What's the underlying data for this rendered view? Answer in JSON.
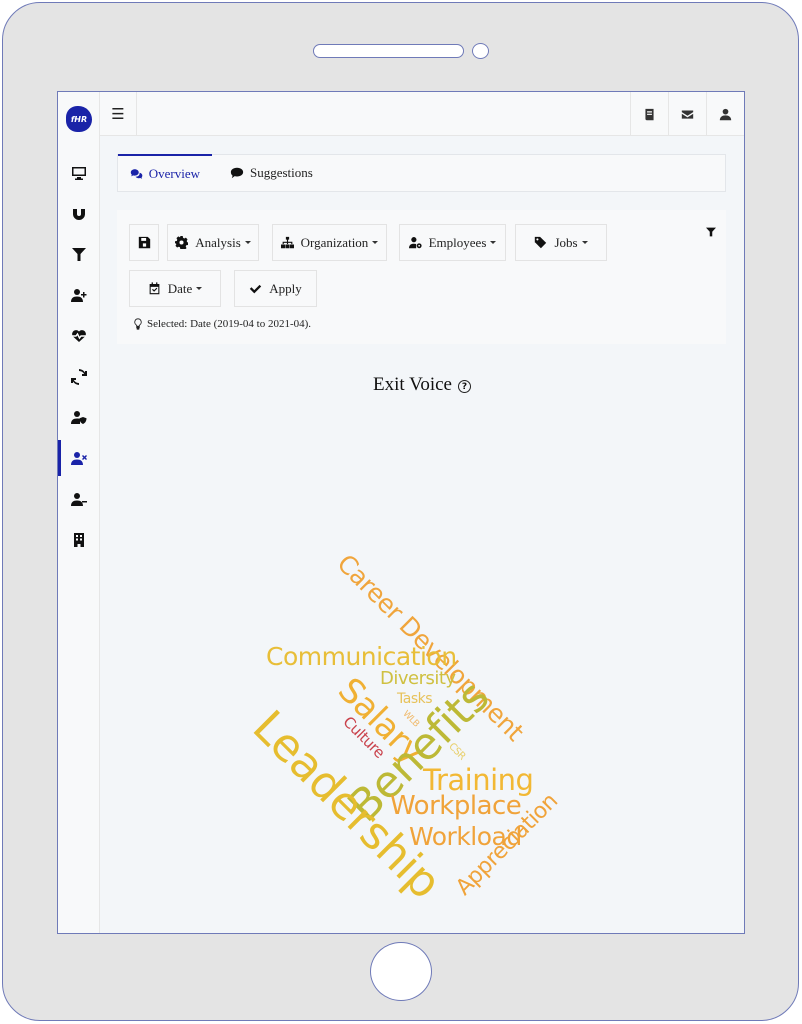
{
  "app": {
    "logo_text": "fHR"
  },
  "topbar": {
    "menu_icon": "hamburger-icon",
    "right_icons": [
      "book-icon",
      "envelope-icon",
      "user-icon"
    ]
  },
  "sidebar": {
    "items": [
      {
        "icon": "desktop-icon",
        "active": false
      },
      {
        "icon": "magnet-icon",
        "active": false
      },
      {
        "icon": "filter-icon",
        "active": false
      },
      {
        "icon": "user-plus-icon",
        "active": false
      },
      {
        "icon": "heartbeat-icon",
        "active": false
      },
      {
        "icon": "sync-icon",
        "active": false
      },
      {
        "icon": "user-shield-icon",
        "active": false
      },
      {
        "icon": "user-times-icon",
        "active": true
      },
      {
        "icon": "user-minus-icon",
        "active": false
      },
      {
        "icon": "building-icon",
        "active": false
      }
    ]
  },
  "tabs": [
    {
      "label": "Overview",
      "icon": "comments-icon",
      "active": true
    },
    {
      "label": "Suggestions",
      "icon": "comment-icon",
      "active": false
    }
  ],
  "filters": {
    "save_icon": "save-icon",
    "buttons": [
      {
        "label": "Analysis",
        "icon": "cog-icon",
        "dropdown": true
      },
      {
        "label": "Organization",
        "icon": "sitemap-icon",
        "dropdown": true
      },
      {
        "label": "Employees",
        "icon": "user-cog-icon",
        "dropdown": true
      },
      {
        "label": "Jobs",
        "icon": "tag-icon",
        "dropdown": true
      },
      {
        "label": "Date",
        "icon": "calendar-check-icon",
        "dropdown": true
      },
      {
        "label": "Apply",
        "icon": "check-icon",
        "dropdown": false
      }
    ],
    "selected_text": "Selected: Date (2019-04 to 2021-04).",
    "toggle_icon": "filter-icon"
  },
  "section": {
    "title": "Exit Voice",
    "help_icon": "question-circle-icon",
    "help_glyph": "?"
  },
  "word_cloud": {
    "colors": {
      "orange": "#f0a33a",
      "gold": "#e8bd37",
      "olive": "#bfb93a",
      "red": "#c9414b",
      "amber": "#f2b431"
    },
    "words": [
      {
        "text": "Leadership",
        "color": "#e6bd2f",
        "rotation": 45
      },
      {
        "text": "Benefits",
        "color": "#bdb936",
        "rotation": -45
      },
      {
        "text": "Career Development",
        "color": "#f0a53c",
        "rotation": 45
      },
      {
        "text": "Communication",
        "color": "#e8be38",
        "rotation": 0
      },
      {
        "text": "Salary",
        "color": "#f0b033",
        "rotation": 45
      },
      {
        "text": "Training",
        "color": "#f2b834",
        "rotation": 0
      },
      {
        "text": "Workplace",
        "color": "#f0a33a",
        "rotation": 0
      },
      {
        "text": "Workload",
        "color": "#f0a33a",
        "rotation": 0
      },
      {
        "text": "Appreciation",
        "color": "#f0a33a",
        "rotation": -45
      },
      {
        "text": "Diversity",
        "color": "#cfc040",
        "rotation": 0
      },
      {
        "text": "Tasks",
        "color": "#e7c25a",
        "rotation": 0
      },
      {
        "text": "Culture",
        "color": "#c9414b",
        "rotation": 45
      },
      {
        "text": "WLB",
        "color": "#f0b96a",
        "rotation": 45
      },
      {
        "text": "CSR",
        "color": "#e8cf6a",
        "rotation": 45
      }
    ]
  }
}
